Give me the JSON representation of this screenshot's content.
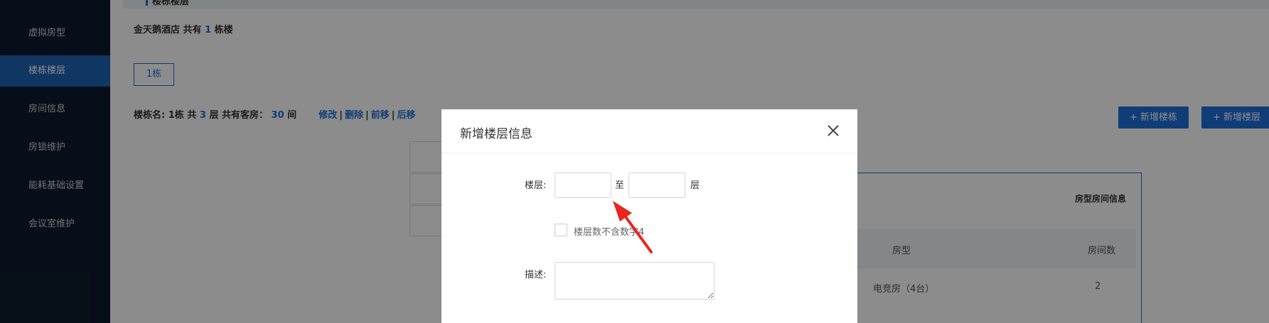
{
  "sidebar": {
    "items": [
      {
        "label": "虚拟房型",
        "active": false
      },
      {
        "label": "楼栋楼层",
        "active": true
      },
      {
        "label": "房间信息",
        "active": false
      },
      {
        "label": "房锁维护",
        "active": false
      },
      {
        "label": "能耗基础设置",
        "active": false
      },
      {
        "label": "会议室维护",
        "active": false
      }
    ]
  },
  "page": {
    "section_title": "楼栋楼层",
    "hotel_name": "金天鹅酒店",
    "hotel_has": "共有",
    "building_count": "1",
    "building_unit": "栋楼",
    "building_tab": "1栋",
    "info": {
      "name_label": "楼栋名:",
      "name_value": "1栋",
      "floors_prefix": "共",
      "floors_count": "3",
      "floors_suffix": "层",
      "rooms_label": "共有客房：",
      "rooms_count": "30",
      "rooms_unit": "间",
      "links": [
        "修改",
        "删除",
        "前移",
        "后移"
      ]
    },
    "buttons": {
      "add_building": "+ 新增楼栋",
      "add_floor": "+ 新增楼层"
    },
    "table": {
      "title": "房型房间信息",
      "col_type": "房型",
      "col_count": "房间数",
      "row1_type": "电竞房（4台）",
      "row1_count": "2"
    }
  },
  "dialog": {
    "title": "新增楼层信息",
    "floor_label": "楼层:",
    "to_label": "至",
    "floor_unit": "层",
    "checkbox_label": "楼层数不含数字4",
    "desc_label": "描述:",
    "floor_from_value": "",
    "floor_to_value": "",
    "desc_value": ""
  },
  "colors": {
    "sidebar_bg": "#0d1b2e",
    "accent": "#1e6fd9",
    "active_item": "#1e63b6",
    "annotation_arrow": "#e8261e"
  }
}
